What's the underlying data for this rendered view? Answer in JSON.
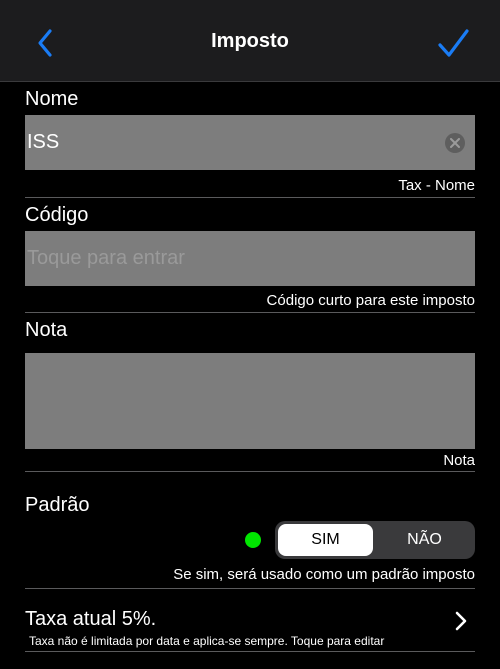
{
  "nav": {
    "title": "Imposto",
    "back_icon": "chevron-left-icon",
    "done_icon": "checkmark-icon",
    "accent_color": "#1a7cf5"
  },
  "form": {
    "name": {
      "label": "Nome",
      "value": "ISS",
      "hint": "Tax - Nome",
      "clear_icon": "clear-circle-icon"
    },
    "code": {
      "label": "Código",
      "value": "",
      "placeholder": "Toque para entrar",
      "hint": "Código curto para este imposto"
    },
    "note": {
      "label": "Nota",
      "value": "",
      "hint": "Nota"
    },
    "default": {
      "label": "Padrão",
      "status_color": "#00e600",
      "options": [
        "SIM",
        "NÃO"
      ],
      "selected": "SIM",
      "hint": "Se sim, será usado como um padrão imposto"
    }
  },
  "rate": {
    "title": "Taxa atual 5%.",
    "subtitle": "Taxa não é limitada por data e aplica-se sempre. Toque para editar",
    "chevron_icon": "chevron-right-icon"
  }
}
